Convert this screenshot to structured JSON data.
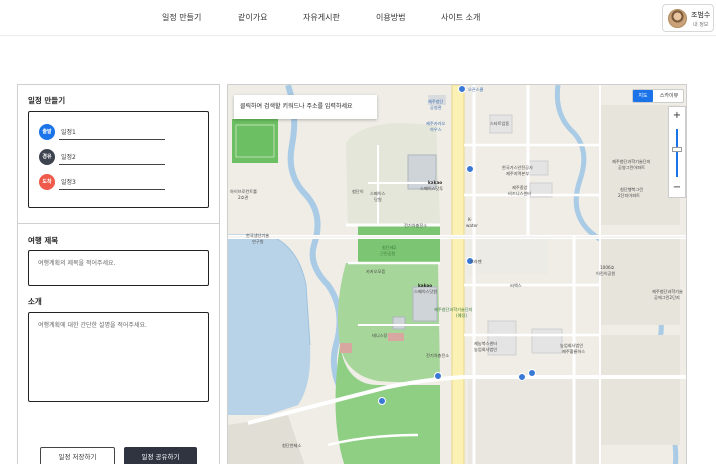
{
  "nav": {
    "items": [
      "일정 만들기",
      "같이가요",
      "자유게시판",
      "이용방법",
      "사이트 소개"
    ],
    "profile_name": "조범수",
    "profile_sub": "내 정보"
  },
  "plan": {
    "section_title": "일정 만들기",
    "steps": [
      {
        "badge": "출발",
        "label": "일정1",
        "color": "#1a73e8"
      },
      {
        "badge": "경유",
        "label": "일정2",
        "color": "#3d4450"
      },
      {
        "badge": "도착",
        "label": "일정3",
        "color": "#f05a4a"
      }
    ],
    "title_label": "여행 제목",
    "title_placeholder": "여행계획의 제목을 적어주세요.",
    "intro_label": "소개",
    "intro_placeholder": "여행계획에 대한 간단한 설명을 적어주세요.",
    "save_button": "일정 저장하기",
    "share_button": "일정 공유하기"
  },
  "map": {
    "hint": "클릭하여 검색할 키워드나 주소를 입력하세요",
    "type_map": "지도",
    "type_skyview": "스카이뷰",
    "zoom_in": "+",
    "zoom_out": "−",
    "labels": {
      "l1": "오픈스쿨",
      "l2": "제주첨단",
      "l3": "공영관",
      "l4": "제주카카오",
      "l5": "하우스",
      "l6": "스타트업동",
      "l7": "한국가스안전공사",
      "l8": "제주지역본부",
      "l9": "제주중앙",
      "l10": "비즈니스센터",
      "l11": "kakao",
      "l12": "스페이스닷투",
      "l13": "전기차충전소",
      "l14": "K-",
      "l15": "water",
      "l16": "첨단이",
      "l17": "스페이스",
      "l18": "닷원",
      "l19": "하이브로컨트롤",
      "l20": "2호관",
      "l21": "한국생산기술",
      "l22": "연구원",
      "l23": "첨단제2",
      "l24": "근린공원",
      "l25": "오라벤",
      "l26": "카카오모음",
      "l27": "kakao",
      "l28": "스페이스닷원",
      "l29": "제주첨단과학기술단지",
      "l30": "(예정)",
      "l31": "테니스장",
      "l32": "전기차충전소",
      "l33": "제주첨단과학기술단지",
      "l34": "공영그린아파트",
      "l35": "첨단행복그린",
      "l36": "2단지아파트",
      "l37": "1006호",
      "l38": "어린이공원",
      "l39": "제주첨단과학기술",
      "l40": "공에그린2단지",
      "l41": "제농북스센터",
      "l42": "농업회사법인",
      "l43": "농업회사법인",
      "l44": "제주황룡하스",
      "l45": "씨엑스",
      "l46": "첨단연제소"
    }
  }
}
